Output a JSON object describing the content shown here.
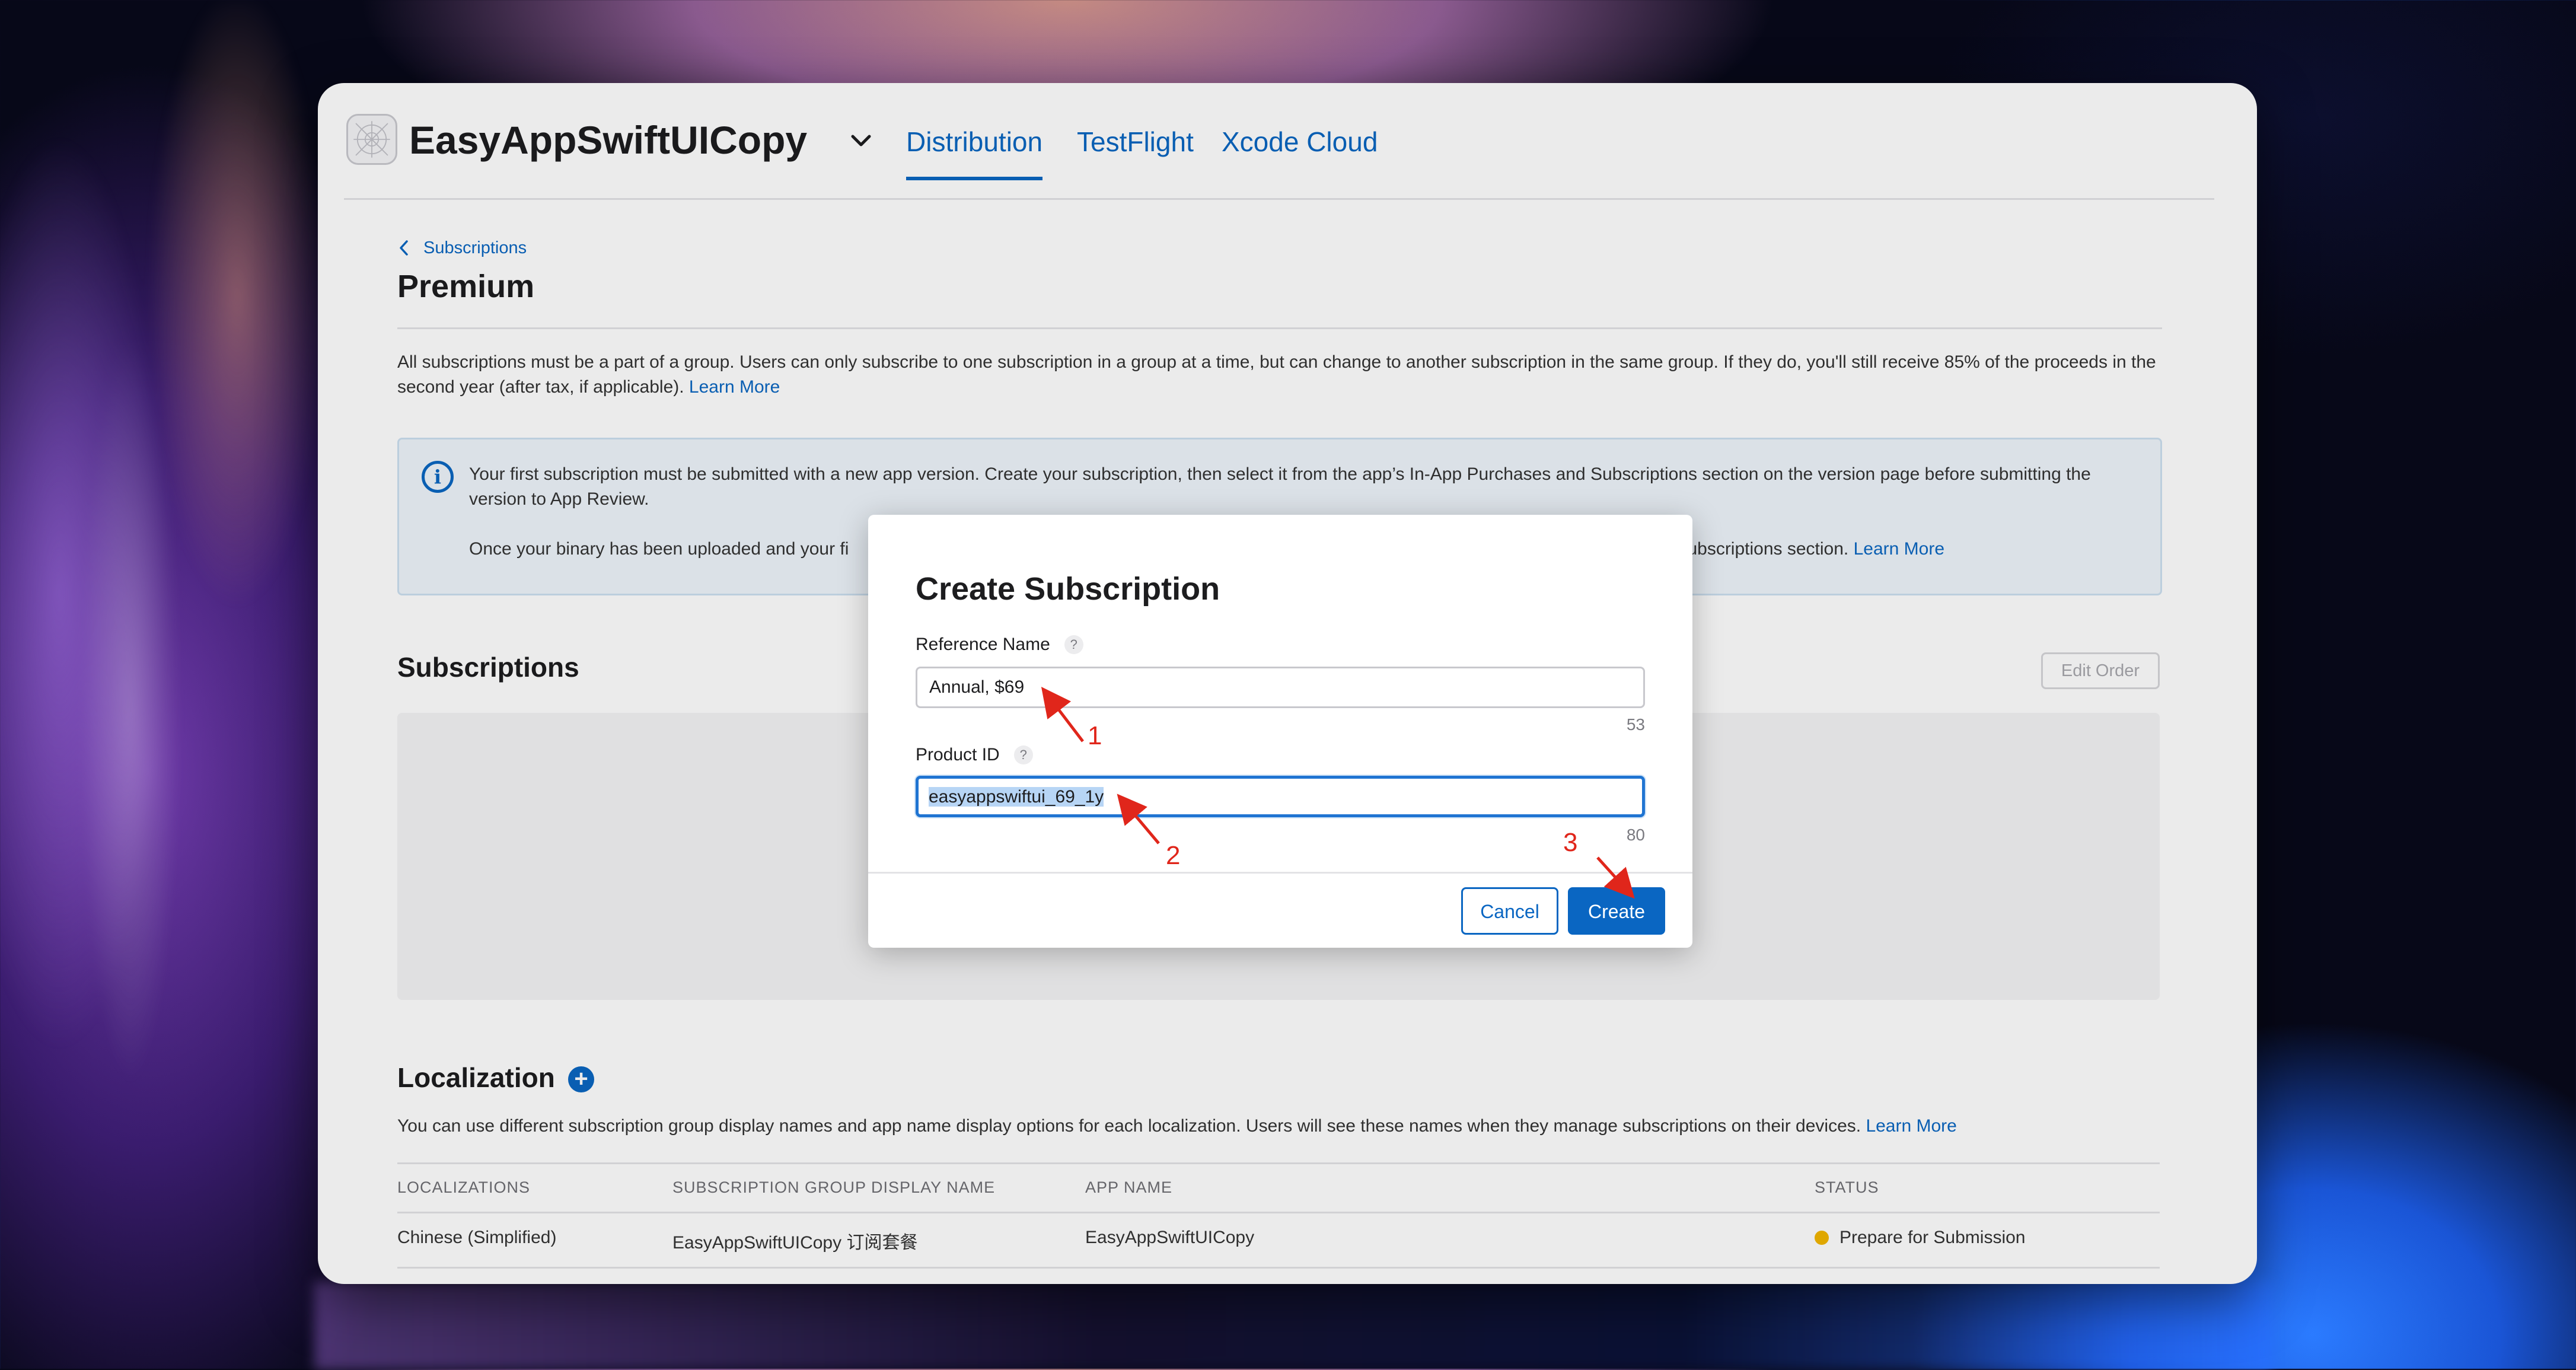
{
  "window": {
    "app_name": "EasyAppSwiftUICopy",
    "tabs": [
      {
        "label": "Distribution",
        "active": true
      },
      {
        "label": "TestFlight",
        "active": false
      },
      {
        "label": "Xcode Cloud",
        "active": false
      }
    ]
  },
  "page": {
    "breadcrumb": "Subscriptions",
    "title": "Premium",
    "intro": "All subscriptions must be a part of a group. Users can only subscribe to one subscription in a group at a time, but can change to another subscription in the same group. If they do, you'll still receive 85% of the proceeds in the second year (after tax, if applicable).",
    "intro_link": "Learn More",
    "info": {
      "line1": "Your first subscription must be submitted with a new app version. Create your subscription, then select it from the app’s In-App Purchases and Subscriptions section on the version page before submitting the version to App Review.",
      "line2_start": "Once your binary has been uploaded and your fi",
      "line2_end": "Subscriptions section.",
      "link": "Learn More"
    },
    "subscriptions": {
      "title": "Subscriptions",
      "edit_order": "Edit Order"
    },
    "localization": {
      "title": "Localization",
      "add_label": "+",
      "description": "You can use different subscription group display names and app name display options for each localization. Users will see these names when they manage subscriptions on their devices.",
      "learn_more": "Learn More",
      "columns": [
        "LOCALIZATIONS",
        "SUBSCRIPTION GROUP DISPLAY NAME",
        "APP NAME",
        "STATUS"
      ],
      "rows": [
        {
          "localization": "Chinese (Simplified)",
          "group_display_name": "EasyAppSwiftUICopy 订阅套餐",
          "app_name": "EasyAppSwiftUICopy",
          "status": "Prepare for Submission",
          "status_color": "#f2b600"
        }
      ]
    }
  },
  "modal": {
    "title": "Create Subscription",
    "reference_name": {
      "label": "Reference Name",
      "help": "?",
      "value": "Annual, $69",
      "remaining": "53"
    },
    "product_id": {
      "label": "Product ID",
      "help": "?",
      "value": "easyappswiftui_69_1y",
      "remaining": "80"
    },
    "cancel_label": "Cancel",
    "create_label": "Create"
  },
  "annotations": [
    "1",
    "2",
    "3"
  ],
  "colors": {
    "accent": "#0a66c2",
    "annotation": "#e0261b"
  }
}
